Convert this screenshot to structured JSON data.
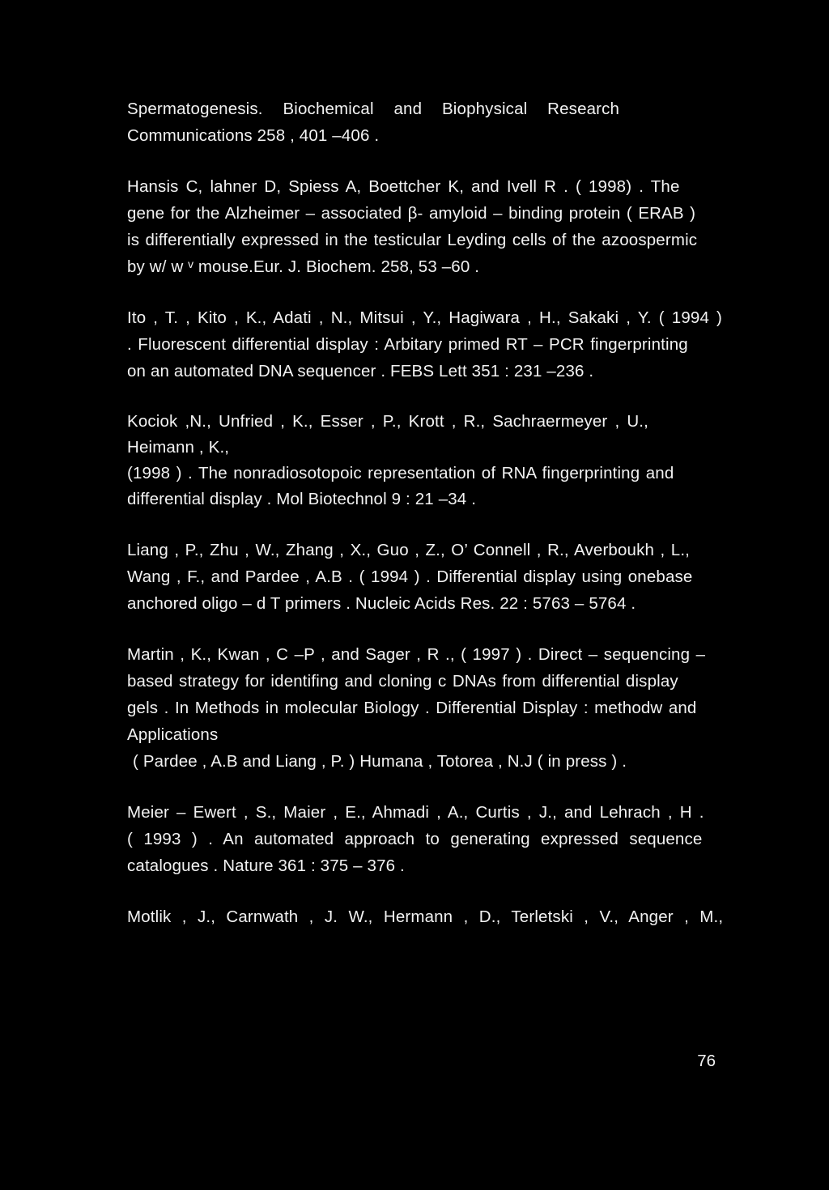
{
  "page": {
    "background_color": "#000000",
    "text_color": "#f2f2f2",
    "page_number": "76",
    "document_type": "scanned-references-page"
  },
  "references": [
    {
      "id": "ref-continuation-spermatogenesis",
      "lines": [
        "Spermatogenesis.   Biochemical   and   Biophysical   Research",
        "Communications 258 , 401 –406 ."
      ]
    },
    {
      "id": "ref-hansis-1998",
      "lines": [
        "Hansis C, lahner D, Spiess A,  Boettcher K, and Ivell R . ( 1998) . The",
        "gene for the Alzheimer – associated  β- amyloid – binding protein ( ERAB )",
        "is differentially expressed in the testicular Leyding cells of the azoospermic",
        "by w/ w ᵛ mouse.Eur. J. Biochem. 258,  53 –60 ."
      ]
    },
    {
      "id": "ref-ito-1994",
      "lines": [
        "Ito , T. , Kito , K., Adati , N., Mitsui  , Y., Hagiwara , H., Sakaki , Y. ( 1994 )",
        ". Fluorescent differential display : Arbitary primed RT – PCR fingerprinting",
        "on an automated  DNA sequencer . FEBS Lett 351 : 231 –236 ."
      ]
    },
    {
      "id": "ref-kociok-1998",
      "lines": [
        "Kociok ,N., Unfried , K., Esser , P.,  Krott , R.,  Sachraermeyer , U.,",
        "Heimann , K.,",
        "(1998 ) . The nonradiosotopoic representation of RNA fingerprinting and",
        "differential display . Mol Biotechnol 9 : 21 –34 ."
      ]
    },
    {
      "id": "ref-liang-1994",
      "lines": [
        "Liang , P., Zhu , W., Zhang , X., Guo , Z.,  O’ Connell , R., Averboukh , L.,",
        "Wang , F., and Pardee , A.B . ( 1994 ) . Differential display using onebase",
        "anchored oligo – d T primers . Nucleic Acids Res. 22 : 5763 – 5764 ."
      ]
    },
    {
      "id": "ref-martin-1997",
      "lines": [
        "Martin , K., Kwan , C –P , and Sager , R .,  ( 1997 ) . Direct – sequencing –",
        "based strategy for identifing and cloning c DNAs from differential display",
        "gels . In Methods in molecular Biology . Differential Display : methodw and",
        "Applications",
        " ( Pardee , A.B and Liang , P. ) Humana , Totorea , N.J ( in press ) ."
      ]
    },
    {
      "id": "ref-meier-ewert-1993",
      "lines": [
        "Meier – Ewert , S.,  Maier , E., Ahmadi , A., Curtis , J.,  and Lehrach , H .",
        "( 1993 ) . An  automated  approach  to  generating  expressed  sequence",
        "catalogues . Nature 361 : 375 – 376 ."
      ]
    },
    {
      "id": "ref-motlik",
      "lines": [
        "Motlik , J., Carnwath , J. W., Hermann , D.,  Terletski , V., Anger , M.,"
      ]
    }
  ]
}
